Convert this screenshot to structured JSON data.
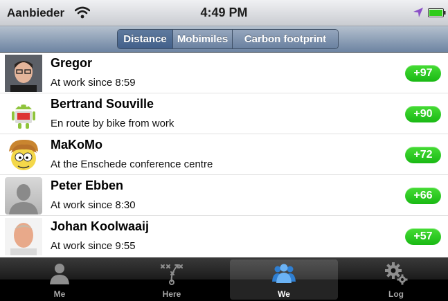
{
  "status_bar": {
    "carrier": "Aanbieder",
    "time": "4:49 PM",
    "icons": [
      "wifi-icon",
      "location-arrow-icon",
      "battery-icon"
    ]
  },
  "segmented_control": {
    "segments": [
      "Distance",
      "Mobimiles",
      "Carbon footprint"
    ],
    "selected": "Distance"
  },
  "list": {
    "items": [
      {
        "name": "Gregor",
        "status": "At work since 8:59",
        "score": "+97",
        "avatar": "photo-man-glasses"
      },
      {
        "name": "Bertrand Souville",
        "status": "En route by bike from work",
        "score": "+90",
        "avatar": "android-robot"
      },
      {
        "name": "MaKoMo",
        "status": "At the Enschede conference centre",
        "score": "+72",
        "avatar": "cartoon-face"
      },
      {
        "name": "Peter Ebben",
        "status": "At work since 8:30",
        "score": "+66",
        "avatar": "default-silhouette"
      },
      {
        "name": "Johan Koolwaaij",
        "status": "At work since 9:55",
        "score": "+57",
        "avatar": "photo-man"
      }
    ]
  },
  "tab_bar": {
    "tabs": [
      {
        "label": "Me",
        "icon": "person-icon"
      },
      {
        "label": "Here",
        "icon": "play-diagram-icon"
      },
      {
        "label": "We",
        "icon": "group-icon"
      },
      {
        "label": "Log",
        "icon": "gears-icon"
      }
    ],
    "selected": "We"
  },
  "colors": {
    "badge_green": "#19b914",
    "nav_blue": "#6d84a2",
    "selected_segment": "#42608a",
    "tab_bar_black": "#000000",
    "selected_tab_icon": "#3d8ee0"
  }
}
